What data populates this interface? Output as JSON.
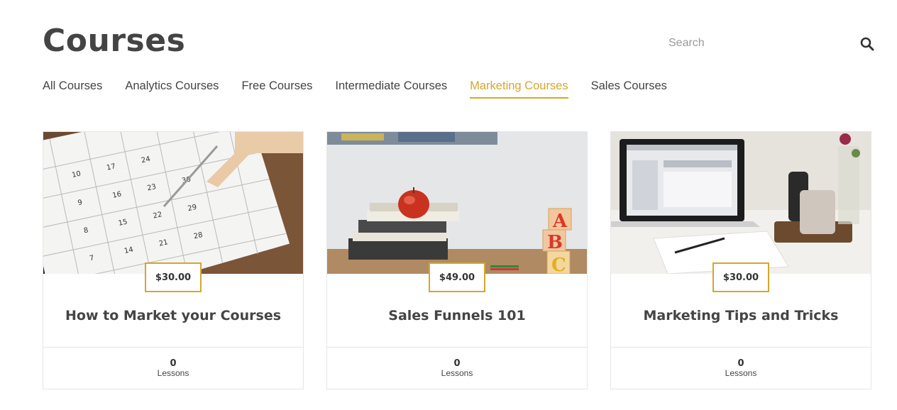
{
  "header": {
    "title": "Courses",
    "search_placeholder": "Search",
    "search_value": ""
  },
  "tabs": [
    {
      "label": "All Courses",
      "active": false
    },
    {
      "label": "Analytics Courses",
      "active": false
    },
    {
      "label": "Free Courses",
      "active": false
    },
    {
      "label": "Intermediate Courses",
      "active": false
    },
    {
      "label": "Marketing Courses",
      "active": true
    },
    {
      "label": "Sales Courses",
      "active": false
    }
  ],
  "courses": [
    {
      "title": "How to Market your Courses",
      "price": "$30.00",
      "lessons_count": "0",
      "lessons_label": "Lessons",
      "image": "calendar-photo"
    },
    {
      "title": "Sales Funnels 101",
      "price": "$49.00",
      "lessons_count": "0",
      "lessons_label": "Lessons",
      "image": "apple-books-photo"
    },
    {
      "title": "Marketing Tips and Tricks",
      "price": "$30.00",
      "lessons_count": "0",
      "lessons_label": "Lessons",
      "image": "laptop-desk-photo"
    }
  ],
  "colors": {
    "accent": "#d4a72c",
    "text": "#444444",
    "border": "#e6e6e6"
  }
}
